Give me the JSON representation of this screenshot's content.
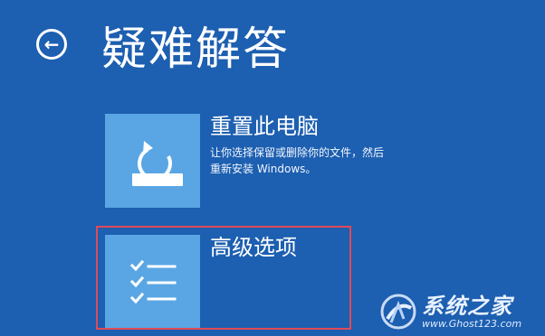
{
  "header": {
    "back_icon": "arrow-left-circle-icon",
    "title": "疑难解答"
  },
  "options": [
    {
      "title": "重置此电脑",
      "description": "让你选择保留或删除你的文件，然后\n重新安装 Windows。",
      "icon": "reset-pc-icon"
    },
    {
      "title": "高级选项",
      "description": "",
      "icon": "checklist-icon"
    }
  ],
  "watermark": {
    "brand": "系统之家",
    "url": "www.Ghost123.com"
  },
  "colors": {
    "background": "#1d5fb0",
    "tile": "#5aa6e4",
    "highlight_border": "#e04a58"
  }
}
